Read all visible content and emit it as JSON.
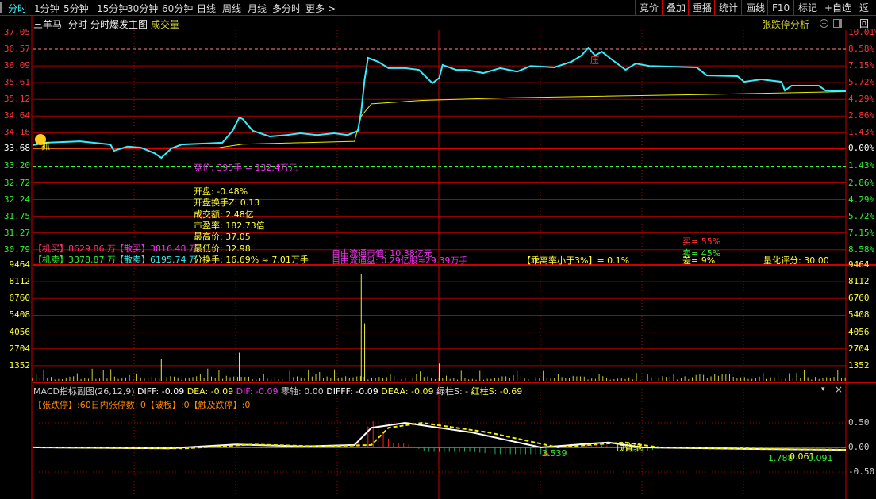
{
  "topbar": {
    "tabs": [
      "分时",
      "1分钟",
      "5分钟",
      "15分钟",
      "30分钟",
      "60分钟",
      "日线",
      "周线",
      "月线",
      "多分时",
      "更多 >"
    ],
    "active": 0,
    "right_buttons": [
      "竞价",
      "叠加",
      "重播",
      "统计",
      "画线",
      "F10",
      "标记",
      "+自选",
      "返回"
    ]
  },
  "header": {
    "stock": "三羊马",
    "view": "分时",
    "indicator": "分时爆发主图",
    "volume_label": "成交量",
    "analysis": "张跌停分析"
  },
  "price_axis": {
    "left": [
      "37.05",
      "36.57",
      "36.09",
      "35.61",
      "35.12",
      "34.64",
      "34.16",
      "33.68",
      "33.20",
      "32.72",
      "32.24",
      "31.75",
      "31.27",
      "30.79"
    ],
    "right": [
      "10.01%",
      "8.58%",
      "7.15%",
      "5.72%",
      "4.29%",
      "2.86%",
      "1.43%",
      "0.00%",
      "1.43%",
      "2.86%",
      "4.29%",
      "5.72%",
      "7.15%",
      "8.58%"
    ]
  },
  "volume_axis": [
    "9464",
    "8112",
    "6760",
    "5408",
    "4056",
    "2704",
    "1352"
  ],
  "macd_axis": [
    "0.50",
    "0.00",
    "-0.50"
  ],
  "info": {
    "auction": "竞价: 395手 = 132.4万元",
    "open": "开盘: -0.48%",
    "open_turnover": "开盘换手Z: 0.13",
    "amount": "成交额: 2.48亿",
    "pe": "市盈率: 182.73倍",
    "high": "最高价: 37.05",
    "low": "最低价: 32.98",
    "turnover": "分换手: 16.69% ≈ 7.01万手",
    "inst_buy": "【机买】8629.86 万",
    "retail_buy": "【散买】3816.48 万",
    "inst_sell": "【机卖】3378.87 万",
    "retail_sell": "【散卖】6195.74 万",
    "float_mv": "自由流通市值: 10.38亿元",
    "float_shares": "自由流通盘: 0.29亿股≈29.39万手",
    "bias": "【乖离率小于3%】= 0.1%",
    "buy": "买= 55%",
    "sell": "卖= 45%",
    "diff": "差= 9%",
    "score": "量化评分: 30.00",
    "marker_press": "压",
    "marker_grab": "抓"
  },
  "macd": {
    "title": "MACD指标副图(26,12,9)",
    "diff": "DIFF: -0.09",
    "dea": "DEA: -0.09",
    "dif": "DIF: -0.09",
    "zero": "零轴: 0.00",
    "difff": "DIFFF: -0.09",
    "deaa": "DEAA: -0.09",
    "green": "绿柱S: -",
    "red": "红柱S: -0.69",
    "line2": "【张跌停】:60日内张停数: 0【破板】:0【触及跌停】:0",
    "labels": {
      "a": "3.539",
      "b": "顶背驰",
      "c": "1.788",
      "d": "0.061",
      "e": "0.091"
    }
  },
  "chart_data": {
    "type": "line",
    "prev_close": 33.68,
    "price_range": [
      30.79,
      37.05
    ],
    "price": [
      [
        0,
        33.77
      ],
      [
        4,
        33.84
      ],
      [
        14,
        33.88
      ],
      [
        23,
        33.79
      ],
      [
        24,
        33.61
      ],
      [
        28,
        33.73
      ],
      [
        32,
        33.7
      ],
      [
        36,
        33.54
      ],
      [
        38,
        33.41
      ],
      [
        41,
        33.68
      ],
      [
        44,
        33.79
      ],
      [
        51,
        33.82
      ],
      [
        56,
        33.84
      ],
      [
        59,
        34.18
      ],
      [
        61,
        34.56
      ],
      [
        62,
        34.52
      ],
      [
        65,
        34.18
      ],
      [
        70,
        34.02
      ],
      [
        75,
        34.06
      ],
      [
        79,
        34.11
      ],
      [
        84,
        34.06
      ],
      [
        89,
        34.11
      ],
      [
        93,
        34.06
      ],
      [
        96,
        34.18
      ],
      [
        97,
        34.74
      ],
      [
        98,
        35.65
      ],
      [
        99,
        36.26
      ],
      [
        102,
        36.15
      ],
      [
        105,
        35.97
      ],
      [
        110,
        35.97
      ],
      [
        114,
        35.92
      ],
      [
        118,
        35.54
      ],
      [
        120,
        35.69
      ],
      [
        121,
        36.06
      ],
      [
        125,
        35.92
      ],
      [
        128,
        35.92
      ],
      [
        133,
        35.83
      ],
      [
        138,
        35.97
      ],
      [
        143,
        35.87
      ],
      [
        147,
        36.03
      ],
      [
        154,
        35.99
      ],
      [
        159,
        36.15
      ],
      [
        162,
        36.33
      ],
      [
        164,
        36.55
      ],
      [
        166,
        36.33
      ],
      [
        168,
        36.44
      ],
      [
        171,
        36.21
      ],
      [
        175,
        35.92
      ],
      [
        178,
        36.1
      ],
      [
        182,
        36.03
      ],
      [
        189,
        36.01
      ],
      [
        196,
        35.99
      ],
      [
        199,
        35.76
      ],
      [
        208,
        35.74
      ],
      [
        210,
        35.58
      ],
      [
        215,
        35.65
      ],
      [
        221,
        35.58
      ],
      [
        222,
        35.33
      ],
      [
        224,
        35.47
      ],
      [
        232,
        35.47
      ],
      [
        234,
        35.33
      ],
      [
        240,
        35.31
      ]
    ],
    "avg": [
      [
        0,
        33.68
      ],
      [
        55,
        33.7
      ],
      [
        62,
        33.8
      ],
      [
        95,
        33.88
      ],
      [
        97,
        34.6
      ],
      [
        100,
        34.95
      ],
      [
        115,
        35.05
      ],
      [
        140,
        35.12
      ],
      [
        200,
        35.22
      ],
      [
        240,
        35.3
      ]
    ],
    "volume_spikes": [
      [
        38,
        1800
      ],
      [
        61,
        2300
      ],
      [
        97,
        8700
      ],
      [
        98,
        4700
      ],
      [
        120,
        1400
      ]
    ],
    "macd_diff": [
      [
        0,
        0
      ],
      [
        40,
        -0.02
      ],
      [
        60,
        0.06
      ],
      [
        80,
        0.02
      ],
      [
        95,
        0.05
      ],
      [
        100,
        0.4
      ],
      [
        110,
        0.5
      ],
      [
        130,
        0.3
      ],
      [
        150,
        0
      ],
      [
        165,
        0.08
      ],
      [
        170,
        0.1
      ],
      [
        180,
        0.0
      ],
      [
        210,
        -0.03
      ],
      [
        240,
        -0.05
      ]
    ]
  }
}
